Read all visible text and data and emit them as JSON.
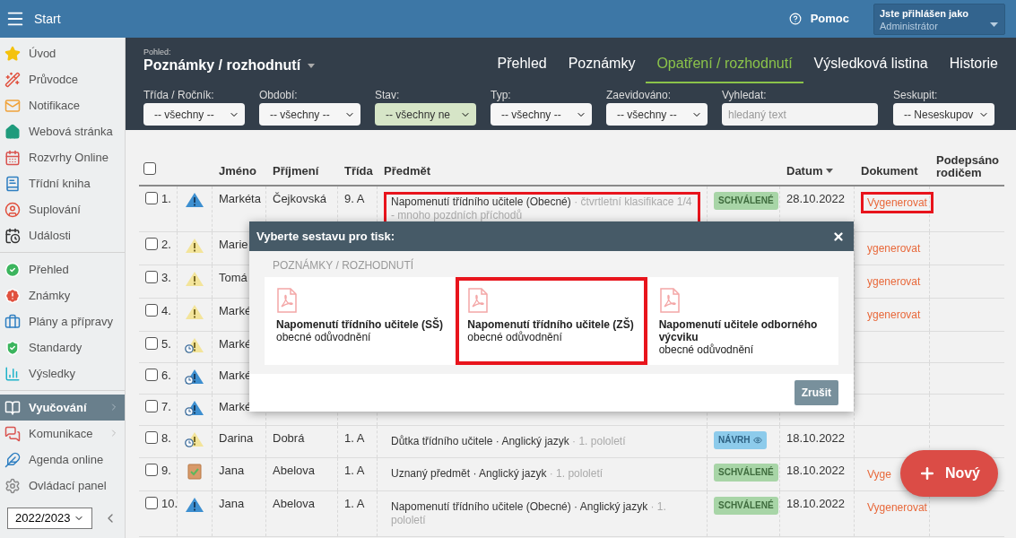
{
  "topbar": {
    "title": "Start",
    "help": "Pomoc",
    "user_label": "Jste přihlášen jako",
    "user_name": "Administrátor"
  },
  "sidebar": {
    "sections": [
      {
        "items": [
          {
            "label": "Úvod",
            "selected": false,
            "submenu": false
          },
          {
            "label": "Průvodce",
            "selected": false,
            "submenu": false
          },
          {
            "label": "Notifikace",
            "selected": false,
            "submenu": false
          },
          {
            "label": "Webová stránka",
            "selected": false,
            "submenu": false
          },
          {
            "label": "Rozvrhy Online",
            "selected": false,
            "submenu": false
          },
          {
            "label": "Třídní kniha",
            "selected": false,
            "submenu": false
          },
          {
            "label": "Suplování",
            "selected": false,
            "submenu": false
          },
          {
            "label": "Události",
            "selected": false,
            "submenu": false
          }
        ]
      },
      {
        "items": [
          {
            "label": "Přehled",
            "selected": false,
            "submenu": false
          },
          {
            "label": "Známky",
            "selected": false,
            "submenu": false
          },
          {
            "label": "Plány a přípravy",
            "selected": false,
            "submenu": false
          },
          {
            "label": "Standardy",
            "selected": false,
            "submenu": false
          },
          {
            "label": "Výsledky",
            "selected": false,
            "submenu": false
          }
        ]
      },
      {
        "items": [
          {
            "label": "Vyučování",
            "selected": true,
            "submenu": true
          },
          {
            "label": "Komunikace",
            "selected": false,
            "submenu": true
          },
          {
            "label": "Agenda online",
            "selected": false,
            "submenu": false
          },
          {
            "label": "Ovládací panel",
            "selected": false,
            "submenu": false
          }
        ]
      }
    ],
    "year_select": {
      "value": "2022/2023"
    }
  },
  "view": {
    "label": "Pohled:",
    "title": "Poznámky / rozhodnutí"
  },
  "tabs": [
    {
      "label": "Přehled",
      "selected": false
    },
    {
      "label": "Poznámky",
      "selected": false
    },
    {
      "label": "Opatření / rozhodnutí",
      "selected": true
    },
    {
      "label": "Výsledková listina",
      "selected": false
    },
    {
      "label": "Historie",
      "selected": false
    }
  ],
  "filters": [
    {
      "kind": "select",
      "label": "Třída / Ročník:",
      "value": "-- všechny --",
      "active": false
    },
    {
      "kind": "select",
      "label": "Období:",
      "value": "-- všechny --",
      "active": false
    },
    {
      "kind": "select",
      "label": "Stav:",
      "value": "-- všechny ne",
      "active": true
    },
    {
      "kind": "select",
      "label": "Typ:",
      "value": "-- všechny --",
      "active": false
    },
    {
      "kind": "select",
      "label": "Zaevidováno:",
      "value": "-- všechny --",
      "active": false
    },
    {
      "kind": "search",
      "label": "Vyhledat:",
      "placeholder": "hledaný text",
      "active": false
    },
    {
      "kind": "group",
      "label": "Seskupit:",
      "value": "-- Neseskupov",
      "active": false
    }
  ],
  "table": {
    "select_all_checked": false,
    "columns": [
      {
        "label": "Jméno",
        "sorted": false
      },
      {
        "label": "Příjmení",
        "sorted": false
      },
      {
        "label": "Třída",
        "sorted": false
      },
      {
        "label": "Předmět",
        "sorted": false
      },
      {
        "label": "Datum",
        "sorted": true
      },
      {
        "label": "Dokument",
        "sorted": false
      },
      {
        "label": "Podepsáno rodičem",
        "sorted": false
      }
    ],
    "rows": [
      {
        "number": "1.",
        "checked": false,
        "kind": "warning",
        "first_name": "Markéta",
        "last_name": "Čejkovská",
        "class": "9. A",
        "subject": "Napomenutí třídního učitele (Obecné)",
        "detail": "· čtvrtletní klasifikace 1/4 - mnoho pozdních příchodů",
        "subject_highlighted": true,
        "status": {
          "label": "SCHVÁLENÉ",
          "kind": "approved"
        },
        "date": "28.10.2022",
        "document": "Vygenerovat",
        "document_highlighted": true
      },
      {
        "number": "2.",
        "checked": false,
        "kind": "caution",
        "first_name": "Marie",
        "document": "ygenerovat"
      },
      {
        "number": "3.",
        "checked": false,
        "kind": "caution",
        "first_name": "Tomá",
        "document": "ygenerovat"
      },
      {
        "number": "4.",
        "checked": false,
        "kind": "caution",
        "first_name": "Marké",
        "document": "ygenerovat"
      },
      {
        "number": "5.",
        "checked": false,
        "kind": "pending-caution",
        "first_name": "Marké"
      },
      {
        "number": "6.",
        "checked": false,
        "kind": "pending-warning",
        "first_name": "Marké"
      },
      {
        "number": "7.",
        "checked": false,
        "kind": "pending-warning",
        "first_name": "Marké"
      },
      {
        "number": "8.",
        "checked": false,
        "kind": "pending-caution",
        "first_name": "Darina",
        "last_name": "Dobrá",
        "class": "1. A",
        "subject": "Důtka třídního učitele · Anglický jazyk",
        "detail": "· 1. pololetí",
        "subject_highlighted": false,
        "status": {
          "label": "NÁVRH",
          "kind": "draft"
        },
        "date": "18.10.2022"
      },
      {
        "number": "9.",
        "checked": false,
        "kind": "recognized",
        "first_name": "Jana",
        "last_name": "Abelova",
        "class": "1. A",
        "subject": "Uznaný předmět · Anglický jazyk",
        "detail": "· 1. pololetí",
        "subject_highlighted": false,
        "status": {
          "label": "SCHVÁLENÉ",
          "kind": "approved"
        },
        "date": "18.10.2022",
        "document": "Vyge",
        "document_highlighted": false
      },
      {
        "number": "10.",
        "checked": false,
        "kind": "warning",
        "first_name": "Jana",
        "last_name": "Abelova",
        "class": "1. A",
        "subject": "Napomenutí třídního učitele (Obecné) · Anglický jazyk",
        "detail": "· 1. pololetí",
        "subject_highlighted": false,
        "status": {
          "label": "SCHVÁLENÉ",
          "kind": "approved"
        },
        "date": "18.10.2022",
        "document": "Vygenerovat",
        "document_highlighted": false
      }
    ]
  },
  "modal": {
    "title": "Vyberte sestavu pro tisk:",
    "section": "POZNÁMKY / ROZHODNUTÍ",
    "options": [
      {
        "title": "Napomenutí třídního učitele (SŠ)",
        "subtitle": "obecné odůvodnění",
        "highlighted": false
      },
      {
        "title": "Napomenutí třídního učitele (ZŠ)",
        "subtitle": "obecné odůvodnění",
        "highlighted": true
      },
      {
        "title": "Napomenutí učitele odborného výcviku",
        "subtitle": "obecné odůvodnění",
        "highlighted": false
      }
    ],
    "cancel": "Zrušit"
  },
  "fab": {
    "label": "Nový"
  }
}
